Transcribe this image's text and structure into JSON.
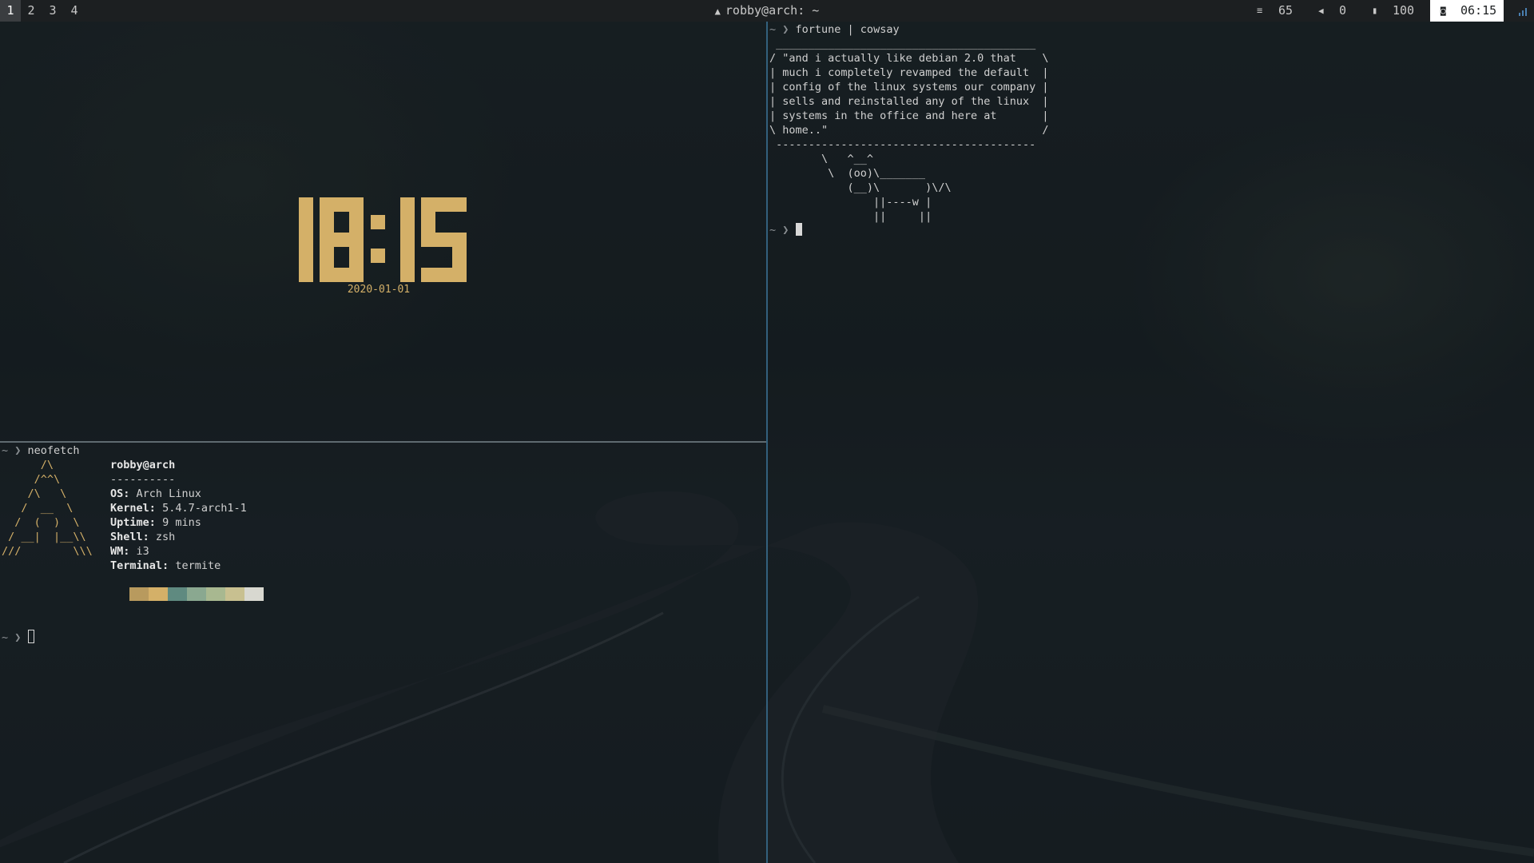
{
  "topbar": {
    "workspaces": [
      "1",
      "2",
      "3",
      "4"
    ],
    "active_workspace": "1",
    "window_title": "robby@arch: ~",
    "window_icon": "arch-logo-icon",
    "brightness_icon": "brightness-icon",
    "brightness": "65",
    "volume_icon": "volume-icon",
    "volume": "0",
    "battery_icon": "battery-icon",
    "battery": "100",
    "clock_icon": "clock-icon",
    "time": "06:15",
    "signal_icon": "wifi-signal-icon"
  },
  "clock_pane": {
    "time": "18:15",
    "date": "2020-01-01",
    "accent_color": "#d4b068"
  },
  "neofetch_pane": {
    "prompt": "~ ❯",
    "command": "neofetch",
    "logo": [
      "      /\\",
      "     /^^\\",
      "    /\\   \\",
      "   /  __  \\",
      "  /  (  )  \\",
      " / __|  |__\\\\",
      "///        \\\\\\"
    ],
    "user_host": "robby@arch",
    "separator": "----------",
    "info": [
      {
        "key": "OS",
        "value": "Arch Linux"
      },
      {
        "key": "Kernel",
        "value": "5.4.7-arch1-1"
      },
      {
        "key": "Uptime",
        "value": "9 mins"
      },
      {
        "key": "Shell",
        "value": "zsh"
      },
      {
        "key": "WM",
        "value": "i3"
      },
      {
        "key": "Terminal",
        "value": "termite"
      }
    ],
    "palette": [
      "#b89a5e",
      "#d4b068",
      "#5f8a80",
      "#8aa890",
      "#a8b890",
      "#c8c090",
      "#d8d8d0"
    ],
    "prompt2": "~ ❯"
  },
  "cowsay_pane": {
    "prompt": "~ ❯",
    "command": "fortune | cowsay",
    "output": [
      " ________________________________________",
      "/ \"and i actually like debian 2.0 that    \\",
      "| much i completely revamped the default  |",
      "| config of the linux systems our company |",
      "| sells and reinstalled any of the linux  |",
      "| systems in the office and here at       |",
      "\\ home..\"                                 /",
      " ----------------------------------------",
      "        \\   ^__^",
      "         \\  (oo)\\_______",
      "            (__)\\       )\\/\\",
      "                ||----w |",
      "                ||     ||"
    ],
    "prompt2": "~ ❯"
  }
}
